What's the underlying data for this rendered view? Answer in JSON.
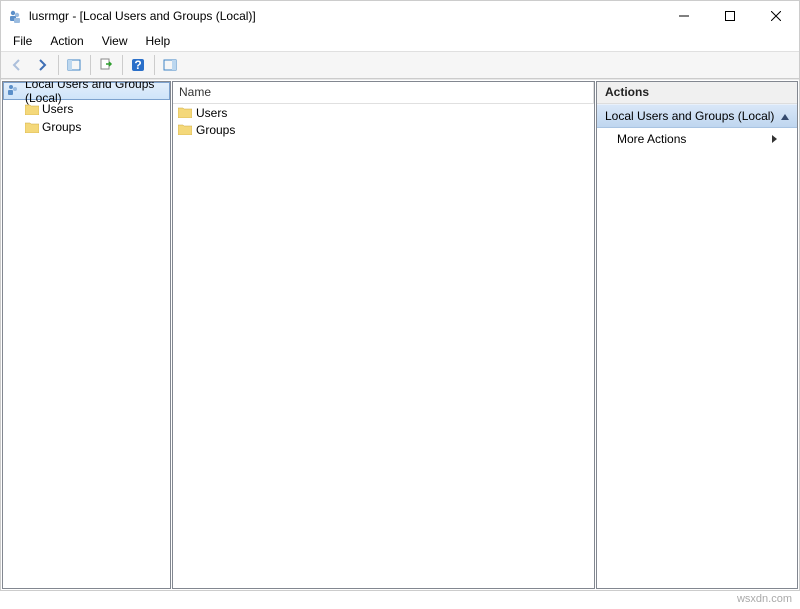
{
  "window": {
    "title": "lusrmgr - [Local Users and Groups (Local)]"
  },
  "menu": {
    "file": "File",
    "action": "Action",
    "view": "View",
    "help": "Help"
  },
  "tree": {
    "root": "Local Users and Groups (Local)",
    "children": [
      "Users",
      "Groups"
    ]
  },
  "list": {
    "header": "Name",
    "rows": [
      "Users",
      "Groups"
    ]
  },
  "actions": {
    "title": "Actions",
    "section": "Local Users and Groups (Local)",
    "more": "More Actions"
  },
  "watermark": "wsxdn.com"
}
